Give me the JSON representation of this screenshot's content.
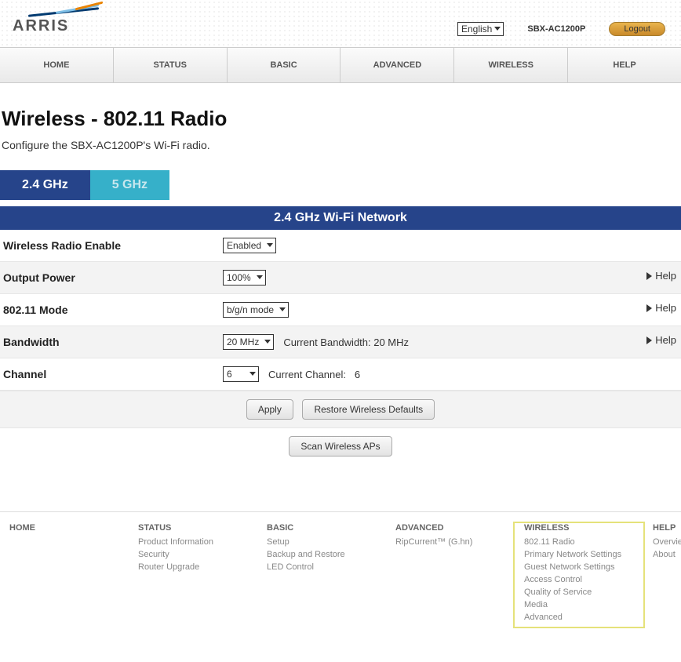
{
  "top": {
    "logo_text": "ARRIS",
    "language": "English",
    "model": "SBX-AC1200P",
    "logout": "Logout"
  },
  "nav": [
    "HOME",
    "STATUS",
    "BASIC",
    "ADVANCED",
    "WIRELESS",
    "HELP"
  ],
  "page": {
    "title": "Wireless - 802.11 Radio",
    "intro": "Configure the SBX-AC1200P's Wi-Fi radio."
  },
  "tabs": {
    "a": "2.4 GHz",
    "b": "5 GHz"
  },
  "section_header": "2.4 GHz Wi-Fi Network",
  "rows": {
    "radio_label": "Wireless Radio Enable",
    "radio_value": "Enabled",
    "power_label": "Output Power",
    "power_value": "100%",
    "mode_label": "802.11 Mode",
    "mode_value": "b/g/n mode",
    "bw_label": "Bandwidth",
    "bw_value": "20 MHz",
    "bw_current": "Current Bandwidth: 20 MHz",
    "ch_label": "Channel",
    "ch_value": "6",
    "ch_current": "Current Channel:   6"
  },
  "help_label": "Help",
  "buttons": {
    "apply": "Apply",
    "restore": "Restore Wireless Defaults",
    "scan": "Scan Wireless APs"
  },
  "footer": {
    "home": {
      "hd": "HOME"
    },
    "status": {
      "hd": "STATUS",
      "items": [
        "Product Information",
        "Security",
        "Router Upgrade"
      ]
    },
    "basic": {
      "hd": "BASIC",
      "items": [
        "Setup",
        "Backup and Restore",
        "LED Control"
      ]
    },
    "advanced": {
      "hd": "ADVANCED",
      "items": [
        "RipCurrent™ (G.hn)"
      ]
    },
    "wireless": {
      "hd": "WIRELESS",
      "items": [
        "802.11 Radio",
        "Primary Network Settings",
        "Guest Network Settings",
        "Access Control",
        "Quality of Service",
        "Media",
        "Advanced"
      ]
    },
    "help": {
      "hd": "HELP",
      "items": [
        "Overview",
        "About"
      ]
    }
  }
}
